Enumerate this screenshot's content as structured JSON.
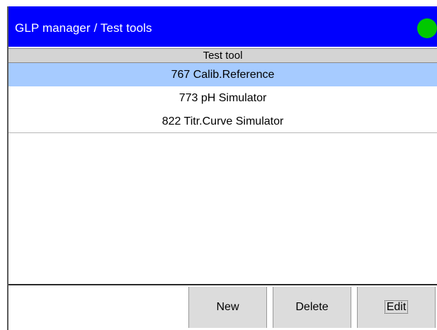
{
  "window": {
    "title": "GLP manager / Test tools",
    "status_color": "#00c800",
    "title_bar_color": "#0000fe"
  },
  "list": {
    "column_header": "Test tool",
    "selected_index": 0,
    "rows": [
      "767 Calib.Reference",
      "773 pH Simulator",
      "822 Titr.Curve Simulator"
    ]
  },
  "buttons": {
    "new_label": "New",
    "delete_label": "Delete",
    "edit_label": "Edit"
  }
}
